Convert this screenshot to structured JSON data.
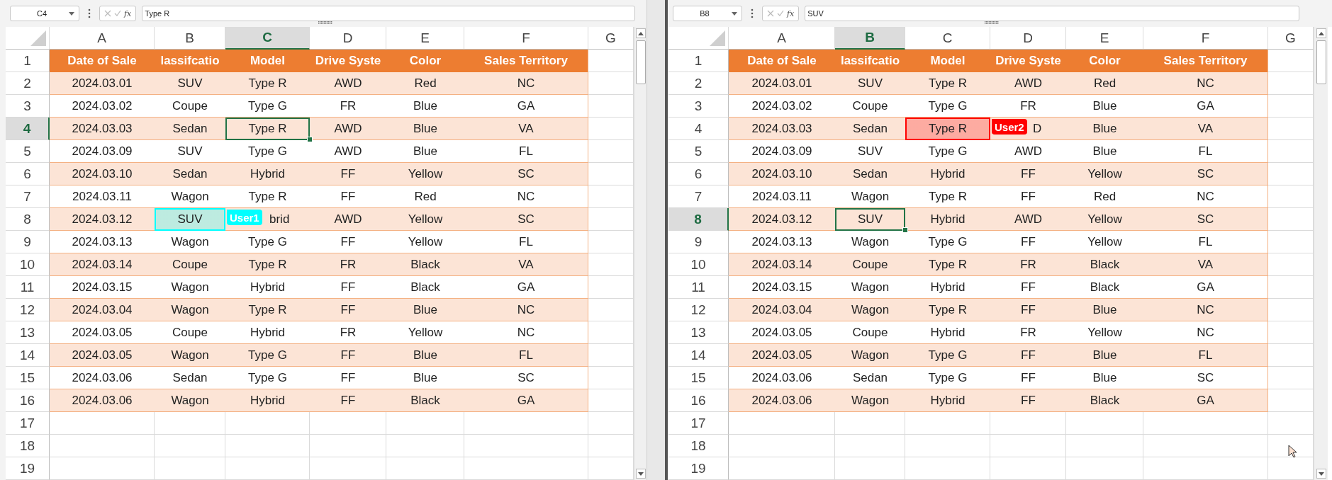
{
  "panes": [
    {
      "name_box": "C4",
      "function_label": "fx",
      "formula": "Type R",
      "columns": [
        {
          "label": "A",
          "selected": false
        },
        {
          "label": "B",
          "selected": false
        },
        {
          "label": "C",
          "selected": true
        },
        {
          "label": "D",
          "selected": false
        },
        {
          "label": "E",
          "selected": false
        },
        {
          "label": "F",
          "selected": false
        },
        {
          "label": "G",
          "selected": false
        }
      ],
      "rows": [
        {
          "number": "1",
          "kind": "header",
          "selected": false,
          "cells": [
            "Date of Sale",
            "lassifcatio",
            "Model",
            "Drive Syste",
            "Color",
            "Sales Territory"
          ]
        },
        {
          "number": "2",
          "kind": "band",
          "selected": false,
          "cells": [
            "2024.03.01",
            "SUV",
            "Type R",
            "AWD",
            "Red",
            "NC"
          ]
        },
        {
          "number": "3",
          "kind": "plain",
          "selected": false,
          "cells": [
            "2024.03.02",
            "Coupe",
            "Type G",
            "FR",
            "Blue",
            "GA"
          ]
        },
        {
          "number": "4",
          "kind": "band",
          "selected": true,
          "cells": [
            "2024.03.03",
            "Sedan",
            "Type R",
            "AWD",
            "Blue",
            "VA"
          ]
        },
        {
          "number": "5",
          "kind": "plain",
          "selected": false,
          "cells": [
            "2024.03.09",
            "SUV",
            "Type G",
            "AWD",
            "Blue",
            "FL"
          ]
        },
        {
          "number": "6",
          "kind": "band",
          "selected": false,
          "cells": [
            "2024.03.10",
            "Sedan",
            "Hybrid",
            "FF",
            "Yellow",
            "SC"
          ]
        },
        {
          "number": "7",
          "kind": "plain",
          "selected": false,
          "cells": [
            "2024.03.11",
            "Wagon",
            "Type R",
            "FF",
            "Red",
            "NC"
          ]
        },
        {
          "number": "8",
          "kind": "band",
          "selected": false,
          "cells": [
            "2024.03.12",
            {
              "text": "SUV",
              "collaborator": {
                "name": "User1",
                "color": "#00ffff"
              }
            },
            "brid",
            "AWD",
            "Yellow",
            "SC"
          ]
        },
        {
          "number": "9",
          "kind": "plain",
          "selected": false,
          "cells": [
            "2024.03.13",
            "Wagon",
            "Type G",
            "FF",
            "Yellow",
            "FL"
          ]
        },
        {
          "number": "10",
          "kind": "band",
          "selected": false,
          "cells": [
            "2024.03.14",
            "Coupe",
            "Type R",
            "FR",
            "Black",
            "VA"
          ]
        },
        {
          "number": "11",
          "kind": "plain",
          "selected": false,
          "cells": [
            "2024.03.15",
            "Wagon",
            "Hybrid",
            "FF",
            "Black",
            "GA"
          ]
        },
        {
          "number": "12",
          "kind": "band",
          "selected": false,
          "cells": [
            "2024.03.04",
            "Wagon",
            "Type R",
            "FF",
            "Blue",
            "NC"
          ]
        },
        {
          "number": "13",
          "kind": "plain",
          "selected": false,
          "cells": [
            "2024.03.05",
            "Coupe",
            "Hybrid",
            "FR",
            "Yellow",
            "NC"
          ]
        },
        {
          "number": "14",
          "kind": "band",
          "selected": false,
          "cells": [
            "2024.03.05",
            "Wagon",
            "Type G",
            "FF",
            "Blue",
            "FL"
          ]
        },
        {
          "number": "15",
          "kind": "plain",
          "selected": false,
          "cells": [
            "2024.03.06",
            "Sedan",
            "Type G",
            "FF",
            "Blue",
            "SC"
          ]
        },
        {
          "number": "16",
          "kind": "band",
          "selected": false,
          "cells": [
            "2024.03.06",
            "Wagon",
            "Hybrid",
            "FF",
            "Black",
            "GA"
          ]
        },
        {
          "number": "17",
          "kind": "empty",
          "selected": false
        },
        {
          "number": "18",
          "kind": "empty",
          "selected": false
        },
        {
          "number": "19",
          "kind": "empty",
          "selected": false
        }
      ]
    },
    {
      "name_box": "B8",
      "function_label": "fx",
      "formula": "SUV",
      "mouse_pointer": true,
      "columns": [
        {
          "label": "A",
          "selected": false
        },
        {
          "label": "B",
          "selected": true
        },
        {
          "label": "C",
          "selected": false
        },
        {
          "label": "D",
          "selected": false
        },
        {
          "label": "E",
          "selected": false
        },
        {
          "label": "F",
          "selected": false
        },
        {
          "label": "G",
          "selected": false
        }
      ],
      "rows": [
        {
          "number": "1",
          "kind": "header",
          "selected": false,
          "cells": [
            "Date of Sale",
            "lassifcatio",
            "Model",
            "Drive Syste",
            "Color",
            "Sales Territory"
          ]
        },
        {
          "number": "2",
          "kind": "band",
          "selected": false,
          "cells": [
            "2024.03.01",
            "SUV",
            "Type R",
            "AWD",
            "Red",
            "NC"
          ]
        },
        {
          "number": "3",
          "kind": "plain",
          "selected": false,
          "cells": [
            "2024.03.02",
            "Coupe",
            "Type G",
            "FR",
            "Blue",
            "GA"
          ]
        },
        {
          "number": "4",
          "kind": "band",
          "selected": false,
          "cells": [
            "2024.03.03",
            "Sedan",
            {
              "text": "Type R",
              "collaborator": {
                "name": "User2",
                "color": "#ff0000"
              }
            },
            "D",
            "Blue",
            "VA"
          ]
        },
        {
          "number": "5",
          "kind": "plain",
          "selected": false,
          "cells": [
            "2024.03.09",
            "SUV",
            "Type G",
            "AWD",
            "Blue",
            "FL"
          ]
        },
        {
          "number": "6",
          "kind": "band",
          "selected": false,
          "cells": [
            "2024.03.10",
            "Sedan",
            "Hybrid",
            "FF",
            "Yellow",
            "SC"
          ]
        },
        {
          "number": "7",
          "kind": "plain",
          "selected": false,
          "cells": [
            "2024.03.11",
            "Wagon",
            "Type R",
            "FF",
            "Red",
            "NC"
          ]
        },
        {
          "number": "8",
          "kind": "band",
          "selected": true,
          "cells": [
            "2024.03.12",
            "SUV",
            "Hybrid",
            "AWD",
            "Yellow",
            "SC"
          ]
        },
        {
          "number": "9",
          "kind": "plain",
          "selected": false,
          "cells": [
            "2024.03.13",
            "Wagon",
            "Type G",
            "FF",
            "Yellow",
            "FL"
          ]
        },
        {
          "number": "10",
          "kind": "band",
          "selected": false,
          "cells": [
            "2024.03.14",
            "Coupe",
            "Type R",
            "FR",
            "Black",
            "VA"
          ]
        },
        {
          "number": "11",
          "kind": "plain",
          "selected": false,
          "cells": [
            "2024.03.15",
            "Wagon",
            "Hybrid",
            "FF",
            "Black",
            "GA"
          ]
        },
        {
          "number": "12",
          "kind": "band",
          "selected": false,
          "cells": [
            "2024.03.04",
            "Wagon",
            "Type R",
            "FF",
            "Blue",
            "NC"
          ]
        },
        {
          "number": "13",
          "kind": "plain",
          "selected": false,
          "cells": [
            "2024.03.05",
            "Coupe",
            "Hybrid",
            "FR",
            "Yellow",
            "NC"
          ]
        },
        {
          "number": "14",
          "kind": "band",
          "selected": false,
          "cells": [
            "2024.03.05",
            "Wagon",
            "Type G",
            "FF",
            "Blue",
            "FL"
          ]
        },
        {
          "number": "15",
          "kind": "plain",
          "selected": false,
          "cells": [
            "2024.03.06",
            "Sedan",
            "Type G",
            "FF",
            "Blue",
            "SC"
          ]
        },
        {
          "number": "16",
          "kind": "band",
          "selected": false,
          "cells": [
            "2024.03.06",
            "Wagon",
            "Hybrid",
            "FF",
            "Black",
            "GA"
          ]
        },
        {
          "number": "17",
          "kind": "empty",
          "selected": false
        },
        {
          "number": "18",
          "kind": "empty",
          "selected": false
        },
        {
          "number": "19",
          "kind": "empty",
          "selected": false
        }
      ]
    }
  ]
}
